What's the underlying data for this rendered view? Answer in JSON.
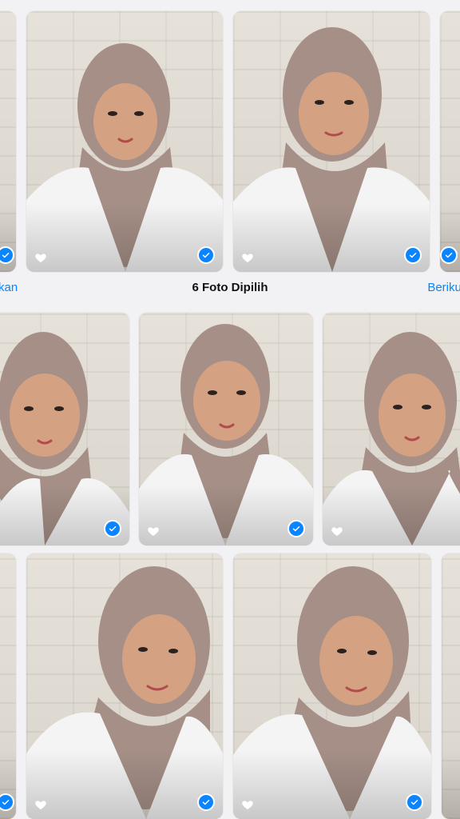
{
  "header": {
    "title": "6 Foto Dipilih",
    "left_action": "kan",
    "right_action": "Berikut"
  },
  "rows": [
    {
      "name": "row-top",
      "photos": [
        {
          "id": "p1",
          "selected": true,
          "favorite": true
        },
        {
          "id": "p2",
          "selected": true,
          "favorite": true
        },
        {
          "id": "p3",
          "selected": true,
          "favorite": true
        },
        {
          "id": "p4",
          "selected": true,
          "favorite": false
        }
      ]
    },
    {
      "name": "row-middle",
      "photos": [
        {
          "id": "p5",
          "selected": true,
          "favorite": false
        },
        {
          "id": "p6",
          "selected": true,
          "favorite": true
        },
        {
          "id": "p7",
          "selected": false,
          "favorite": true
        }
      ]
    },
    {
      "name": "row-bottom",
      "photos": [
        {
          "id": "p8",
          "selected": true,
          "favorite": false
        },
        {
          "id": "p9",
          "selected": true,
          "favorite": true
        },
        {
          "id": "p10",
          "selected": true,
          "favorite": true
        },
        {
          "id": "p11",
          "selected": false,
          "favorite": false
        }
      ]
    }
  ],
  "colors": {
    "accent": "#0a84ff",
    "hijab": "#a58f87",
    "shirt": "#f4f4f4",
    "skin": "#d5a183",
    "wall": "#e6e2da"
  }
}
